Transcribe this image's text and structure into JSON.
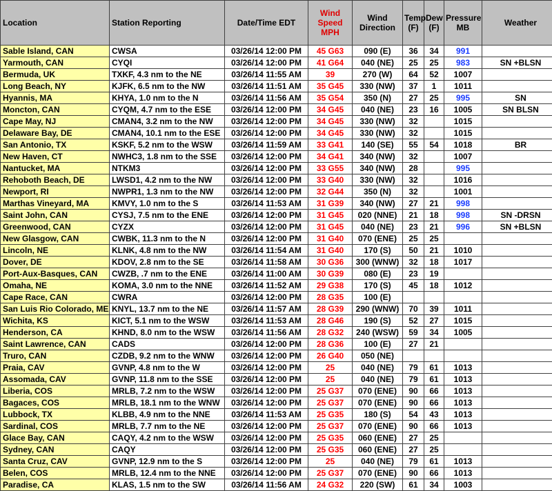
{
  "headers": {
    "location": "Location",
    "station": "Station Reporting",
    "datetime": "Date/Time EDT",
    "wind_speed": [
      "Wind",
      "Speed",
      "MPH"
    ],
    "wind_direction": [
      "Wind",
      "Direction"
    ],
    "temp": [
      "Temp",
      "(F)"
    ],
    "dew": [
      "Dew",
      "(F)"
    ],
    "pressure": [
      "Pressure",
      "MB"
    ],
    "weather": "Weather"
  },
  "colors": {
    "header_bg": "#c0c0c0",
    "location_bg": "#ffffa8",
    "wind_speed_text": "#ff0000",
    "high_pressure_text": "#1a3cff"
  },
  "rows": [
    {
      "location": "Sable Island, CAN",
      "station": "CWSA",
      "datetime": "03/26/14 12:00 PM",
      "wind_speed": "45 G63",
      "wind_dir": "090 (E)",
      "temp": "36",
      "dew": "34",
      "pressure": "991",
      "pressure_blue": true,
      "weather": ""
    },
    {
      "location": "Yarmouth, CAN",
      "station": "CYQI",
      "datetime": "03/26/14 12:00 PM",
      "wind_speed": "41 G64",
      "wind_dir": "040 (NE)",
      "temp": "25",
      "dew": "25",
      "pressure": "983",
      "pressure_blue": true,
      "weather": "SN +BLSN"
    },
    {
      "location": "Bermuda, UK",
      "station": "TXKF, 4.3 nm to the NE",
      "datetime": "03/26/14 11:55 AM",
      "wind_speed": "39",
      "wind_dir": "270 (W)",
      "temp": "64",
      "dew": "52",
      "pressure": "1007",
      "pressure_blue": false,
      "weather": ""
    },
    {
      "location": "Long Beach, NY",
      "station": "KJFK, 6.5 nm to the NW",
      "datetime": "03/26/14 11:51 AM",
      "wind_speed": "35 G45",
      "wind_dir": "330 (NW)",
      "temp": "37",
      "dew": "1",
      "pressure": "1011",
      "pressure_blue": false,
      "weather": ""
    },
    {
      "location": "Hyannis, MA",
      "station": "KHYA, 1.0 nm to the N",
      "datetime": "03/26/14 11:56 AM",
      "wind_speed": "35 G54",
      "wind_dir": "350 (N)",
      "temp": "27",
      "dew": "25",
      "pressure": "995",
      "pressure_blue": true,
      "weather": "SN"
    },
    {
      "location": "Moncton, CAN",
      "station": "CYQM, 4.7 nm to the ESE",
      "datetime": "03/26/14 12:00 PM",
      "wind_speed": "34 G45",
      "wind_dir": "040 (NE)",
      "temp": "23",
      "dew": "16",
      "pressure": "1005",
      "pressure_blue": false,
      "weather": "SN BLSN"
    },
    {
      "location": "Cape May, NJ",
      "station": "CMAN4, 3.2 nm to the NW",
      "datetime": "03/26/14 12:00 PM",
      "wind_speed": "34 G45",
      "wind_dir": "330 (NW)",
      "temp": "32",
      "dew": "",
      "pressure": "1015",
      "pressure_blue": false,
      "weather": ""
    },
    {
      "location": "Delaware Bay, DE",
      "station": "CMAN4, 10.1 nm to the ESE",
      "datetime": "03/26/14 12:00 PM",
      "wind_speed": "34 G45",
      "wind_dir": "330 (NW)",
      "temp": "32",
      "dew": "",
      "pressure": "1015",
      "pressure_blue": false,
      "weather": ""
    },
    {
      "location": "San Antonio, TX",
      "station": "KSKF, 5.2 nm to the WSW",
      "datetime": "03/26/14 11:59 AM",
      "wind_speed": "33 G41",
      "wind_dir": "140 (SE)",
      "temp": "55",
      "dew": "54",
      "pressure": "1018",
      "pressure_blue": false,
      "weather": "BR"
    },
    {
      "location": "New Haven, CT",
      "station": "NWHC3, 1.8 nm to the SSE",
      "datetime": "03/26/14 12:00 PM",
      "wind_speed": "34 G41",
      "wind_dir": "340 (NW)",
      "temp": "32",
      "dew": "",
      "pressure": "1007",
      "pressure_blue": false,
      "weather": ""
    },
    {
      "location": "Nantucket, MA",
      "station": "NTKM3",
      "datetime": "03/26/14 12:00 PM",
      "wind_speed": "33 G55",
      "wind_dir": "340 (NW)",
      "temp": "28",
      "dew": "",
      "pressure": "995",
      "pressure_blue": true,
      "weather": ""
    },
    {
      "location": "Rehoboth Beach, DE",
      "station": "LWSD1, 4.2 nm to the NW",
      "datetime": "03/26/14 12:00 PM",
      "wind_speed": "33 G40",
      "wind_dir": "330 (NW)",
      "temp": "32",
      "dew": "",
      "pressure": "1016",
      "pressure_blue": false,
      "weather": ""
    },
    {
      "location": "Newport, RI",
      "station": "NWPR1, 1.3 nm to the NW",
      "datetime": "03/26/14 12:00 PM",
      "wind_speed": "32 G44",
      "wind_dir": "350 (N)",
      "temp": "32",
      "dew": "",
      "pressure": "1001",
      "pressure_blue": false,
      "weather": ""
    },
    {
      "location": "Marthas Vineyard, MA",
      "station": "KMVY, 1.0 nm to the S",
      "datetime": "03/26/14 11:53 AM",
      "wind_speed": "31 G39",
      "wind_dir": "340 (NW)",
      "temp": "27",
      "dew": "21",
      "pressure": "998",
      "pressure_blue": true,
      "weather": ""
    },
    {
      "location": "Saint John, CAN",
      "station": "CYSJ, 7.5 nm to the ENE",
      "datetime": "03/26/14 12:00 PM",
      "wind_speed": "31 G45",
      "wind_dir": "020 (NNE)",
      "temp": "21",
      "dew": "18",
      "pressure": "998",
      "pressure_blue": true,
      "weather": "SN -DRSN"
    },
    {
      "location": "Greenwood, CAN",
      "station": "CYZX",
      "datetime": "03/26/14 12:00 PM",
      "wind_speed": "31 G45",
      "wind_dir": "040 (NE)",
      "temp": "23",
      "dew": "21",
      "pressure": "996",
      "pressure_blue": true,
      "weather": "SN +BLSN"
    },
    {
      "location": "New Glasgow, CAN",
      "station": "CWBK, 11.3 nm to the N",
      "datetime": "03/26/14 12:00 PM",
      "wind_speed": "31 G40",
      "wind_dir": "070 (ENE)",
      "temp": "25",
      "dew": "25",
      "pressure": "",
      "pressure_blue": false,
      "weather": ""
    },
    {
      "location": "Lincoln, NE",
      "station": "KLNK, 4.8 nm to the NW",
      "datetime": "03/26/14 11:54 AM",
      "wind_speed": "31 G40",
      "wind_dir": "170 (S)",
      "temp": "50",
      "dew": "21",
      "pressure": "1010",
      "pressure_blue": false,
      "weather": ""
    },
    {
      "location": "Dover, DE",
      "station": "KDOV, 2.8 nm to the SE",
      "datetime": "03/26/14 11:58 AM",
      "wind_speed": "30 G36",
      "wind_dir": "300 (WNW)",
      "temp": "32",
      "dew": "18",
      "pressure": "1017",
      "pressure_blue": false,
      "weather": ""
    },
    {
      "location": "Port-Aux-Basques, CAN",
      "station": "CWZB, .7 nm to the ENE",
      "datetime": "03/26/14 11:00 AM",
      "wind_speed": "30 G39",
      "wind_dir": "080 (E)",
      "temp": "23",
      "dew": "19",
      "pressure": "",
      "pressure_blue": false,
      "weather": ""
    },
    {
      "location": "Omaha, NE",
      "station": "KOMA, 3.0 nm to the NNE",
      "datetime": "03/26/14 11:52 AM",
      "wind_speed": "29 G38",
      "wind_dir": "170 (S)",
      "temp": "45",
      "dew": "18",
      "pressure": "1012",
      "pressure_blue": false,
      "weather": ""
    },
    {
      "location": "Cape Race, CAN",
      "station": "CWRA",
      "datetime": "03/26/14 12:00 PM",
      "wind_speed": "28 G35",
      "wind_dir": "100 (E)",
      "temp": "",
      "dew": "",
      "pressure": "",
      "pressure_blue": false,
      "weather": ""
    },
    {
      "location": "San Luis Rio Colorado, MEX",
      "station": "KNYL, 13.7 nm to the NE",
      "datetime": "03/26/14 11:57 AM",
      "wind_speed": "28 G39",
      "wind_dir": "290 (WNW)",
      "temp": "70",
      "dew": "39",
      "pressure": "1011",
      "pressure_blue": false,
      "weather": ""
    },
    {
      "location": "Wichita, KS",
      "station": "KICT, 5.1 nm to the WSW",
      "datetime": "03/26/14 11:53 AM",
      "wind_speed": "28 G46",
      "wind_dir": "190 (S)",
      "temp": "52",
      "dew": "27",
      "pressure": "1015",
      "pressure_blue": false,
      "weather": ""
    },
    {
      "location": "Henderson, CA",
      "station": "KHND, 8.0 nm to the WSW",
      "datetime": "03/26/14 11:56 AM",
      "wind_speed": "28 G32",
      "wind_dir": "240 (WSW)",
      "temp": "59",
      "dew": "34",
      "pressure": "1005",
      "pressure_blue": false,
      "weather": ""
    },
    {
      "location": "Saint Lawrence, CAN",
      "station": "CADS",
      "datetime": "03/26/14 12:00 PM",
      "wind_speed": "28 G36",
      "wind_dir": "100 (E)",
      "temp": "27",
      "dew": "21",
      "pressure": "",
      "pressure_blue": false,
      "weather": ""
    },
    {
      "location": "Truro, CAN",
      "station": "CZDB, 9.2 nm to the WNW",
      "datetime": "03/26/14 12:00 PM",
      "wind_speed": "26 G40",
      "wind_dir": "050 (NE)",
      "temp": "",
      "dew": "",
      "pressure": "",
      "pressure_blue": false,
      "weather": ""
    },
    {
      "location": "Praia, CAV",
      "station": "GVNP, 4.8 nm to the W",
      "datetime": "03/26/14 12:00 PM",
      "wind_speed": "25",
      "wind_dir": "040 (NE)",
      "temp": "79",
      "dew": "61",
      "pressure": "1013",
      "pressure_blue": false,
      "weather": ""
    },
    {
      "location": "Assomada, CAV",
      "station": "GVNP, 11.8 nm to the SSE",
      "datetime": "03/26/14 12:00 PM",
      "wind_speed": "25",
      "wind_dir": "040 (NE)",
      "temp": "79",
      "dew": "61",
      "pressure": "1013",
      "pressure_blue": false,
      "weather": ""
    },
    {
      "location": "Liberia, COS",
      "station": "MRLB, 7.2 nm to the WSW",
      "datetime": "03/26/14 12:00 PM",
      "wind_speed": "25 G37",
      "wind_dir": "070 (ENE)",
      "temp": "90",
      "dew": "66",
      "pressure": "1013",
      "pressure_blue": false,
      "weather": ""
    },
    {
      "location": "Bagaces, COS",
      "station": "MRLB, 18.1 nm to the WNW",
      "datetime": "03/26/14 12:00 PM",
      "wind_speed": "25 G37",
      "wind_dir": "070 (ENE)",
      "temp": "90",
      "dew": "66",
      "pressure": "1013",
      "pressure_blue": false,
      "weather": ""
    },
    {
      "location": "Lubbock, TX",
      "station": "KLBB, 4.9 nm to the NNE",
      "datetime": "03/26/14 11:53 AM",
      "wind_speed": "25 G35",
      "wind_dir": "180 (S)",
      "temp": "54",
      "dew": "43",
      "pressure": "1013",
      "pressure_blue": false,
      "weather": ""
    },
    {
      "location": "Sardinal, COS",
      "station": "MRLB, 7.7 nm to the NE",
      "datetime": "03/26/14 12:00 PM",
      "wind_speed": "25 G37",
      "wind_dir": "070 (ENE)",
      "temp": "90",
      "dew": "66",
      "pressure": "1013",
      "pressure_blue": false,
      "weather": ""
    },
    {
      "location": "Glace Bay, CAN",
      "station": "CAQY, 4.2 nm to the WSW",
      "datetime": "03/26/14 12:00 PM",
      "wind_speed": "25 G35",
      "wind_dir": "060 (ENE)",
      "temp": "27",
      "dew": "25",
      "pressure": "",
      "pressure_blue": false,
      "weather": ""
    },
    {
      "location": "Sydney, CAN",
      "station": "CAQY",
      "datetime": "03/26/14 12:00 PM",
      "wind_speed": "25 G35",
      "wind_dir": "060 (ENE)",
      "temp": "27",
      "dew": "25",
      "pressure": "",
      "pressure_blue": false,
      "weather": ""
    },
    {
      "location": "Santa Cruz, CAV",
      "station": "GVNP, 12.9 nm to the S",
      "datetime": "03/26/14 12:00 PM",
      "wind_speed": "25",
      "wind_dir": "040 (NE)",
      "temp": "79",
      "dew": "61",
      "pressure": "1013",
      "pressure_blue": false,
      "weather": ""
    },
    {
      "location": "Belen, COS",
      "station": "MRLB, 12.4 nm to the NNE",
      "datetime": "03/26/14 12:00 PM",
      "wind_speed": "25 G37",
      "wind_dir": "070 (ENE)",
      "temp": "90",
      "dew": "66",
      "pressure": "1013",
      "pressure_blue": false,
      "weather": ""
    },
    {
      "location": "Paradise, CA",
      "station": "KLAS, 1.5 nm to the SW",
      "datetime": "03/26/14 11:56 AM",
      "wind_speed": "24 G32",
      "wind_dir": "220 (SW)",
      "temp": "61",
      "dew": "34",
      "pressure": "1003",
      "pressure_blue": false,
      "weather": ""
    }
  ]
}
